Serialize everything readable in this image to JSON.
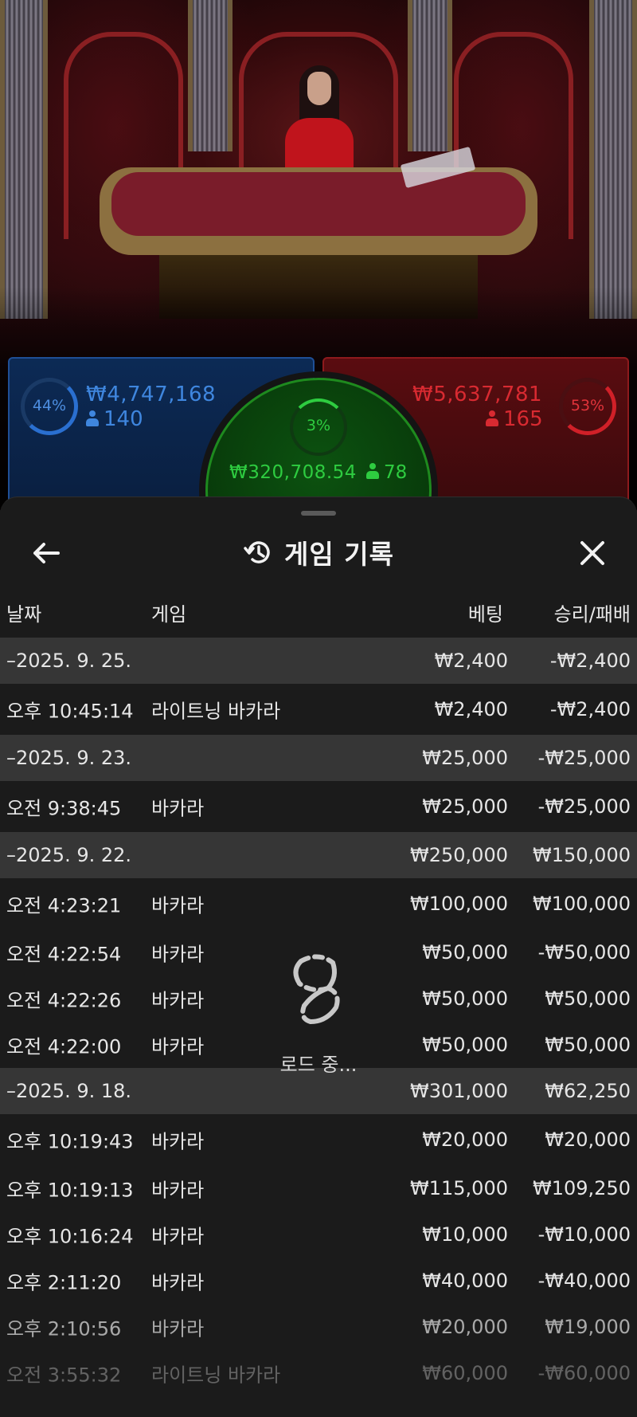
{
  "bets": {
    "player": {
      "percent": "44%",
      "amount": "₩4,747,168",
      "count": "140",
      "color": "#3f86de"
    },
    "banker": {
      "percent": "53%",
      "amount": "₩5,637,781",
      "count": "165",
      "color": "#d82a31"
    },
    "tie": {
      "percent": "3%",
      "amount": "₩320,708.54",
      "count": "78",
      "color": "#2ecc40"
    }
  },
  "sheet": {
    "title": "게임 기록",
    "icons": {
      "back": "arrow-left-icon",
      "history": "history-icon",
      "close": "close-icon"
    },
    "columns": {
      "date": "날짜",
      "game": "게임",
      "bet": "베팅",
      "win_loss": "승리/패배"
    },
    "groups": [
      {
        "date": "–2025. 9. 25.",
        "bet": "₩2,400",
        "win": "-₩2,400",
        "rows": [
          {
            "time": "오후 10:45:14",
            "game": "라이트닝 바카라",
            "bet": "₩2,400",
            "win": "-₩2,400"
          }
        ]
      },
      {
        "date": "–2025. 9. 23.",
        "bet": "₩25,000",
        "win": "-₩25,000",
        "rows": [
          {
            "time": "오전 9:38:45",
            "game": "바카라",
            "bet": "₩25,000",
            "win": "-₩25,000"
          }
        ]
      },
      {
        "date": "–2025. 9. 22.",
        "bet": "₩250,000",
        "win": "₩150,000",
        "rows": [
          {
            "time": "오전 4:23:21",
            "game": "바카라",
            "bet": "₩100,000",
            "win": "₩100,000"
          },
          {
            "time": "오전 4:22:54",
            "game": "바카라",
            "bet": "₩50,000",
            "win": "-₩50,000"
          },
          {
            "time": "오전 4:22:26",
            "game": "바카라",
            "bet": "₩50,000",
            "win": "₩50,000"
          },
          {
            "time": "오전 4:22:00",
            "game": "바카라",
            "bet": "₩50,000",
            "win": "₩50,000"
          }
        ]
      },
      {
        "date": "–2025. 9. 18.",
        "bet": "₩301,000",
        "win": "₩62,250",
        "rows": [
          {
            "time": "오후 10:19:43",
            "game": "바카라",
            "bet": "₩20,000",
            "win": "₩20,000"
          },
          {
            "time": "오후 10:19:13",
            "game": "바카라",
            "bet": "₩115,000",
            "win": "₩109,250"
          },
          {
            "time": "오후 10:16:24",
            "game": "바카라",
            "bet": "₩10,000",
            "win": "-₩10,000"
          },
          {
            "time": "오후 2:11:20",
            "game": "바카라",
            "bet": "₩40,000",
            "win": "-₩40,000"
          },
          {
            "time": "오후 2:10:56",
            "game": "바카라",
            "bet": "₩20,000",
            "win": "₩19,000"
          },
          {
            "time": "오전 3:55:32",
            "game": "라이트닝 바카라",
            "bet": "₩60,000",
            "win": "-₩60,000"
          }
        ]
      }
    ],
    "loading_text": "로드 중..."
  }
}
